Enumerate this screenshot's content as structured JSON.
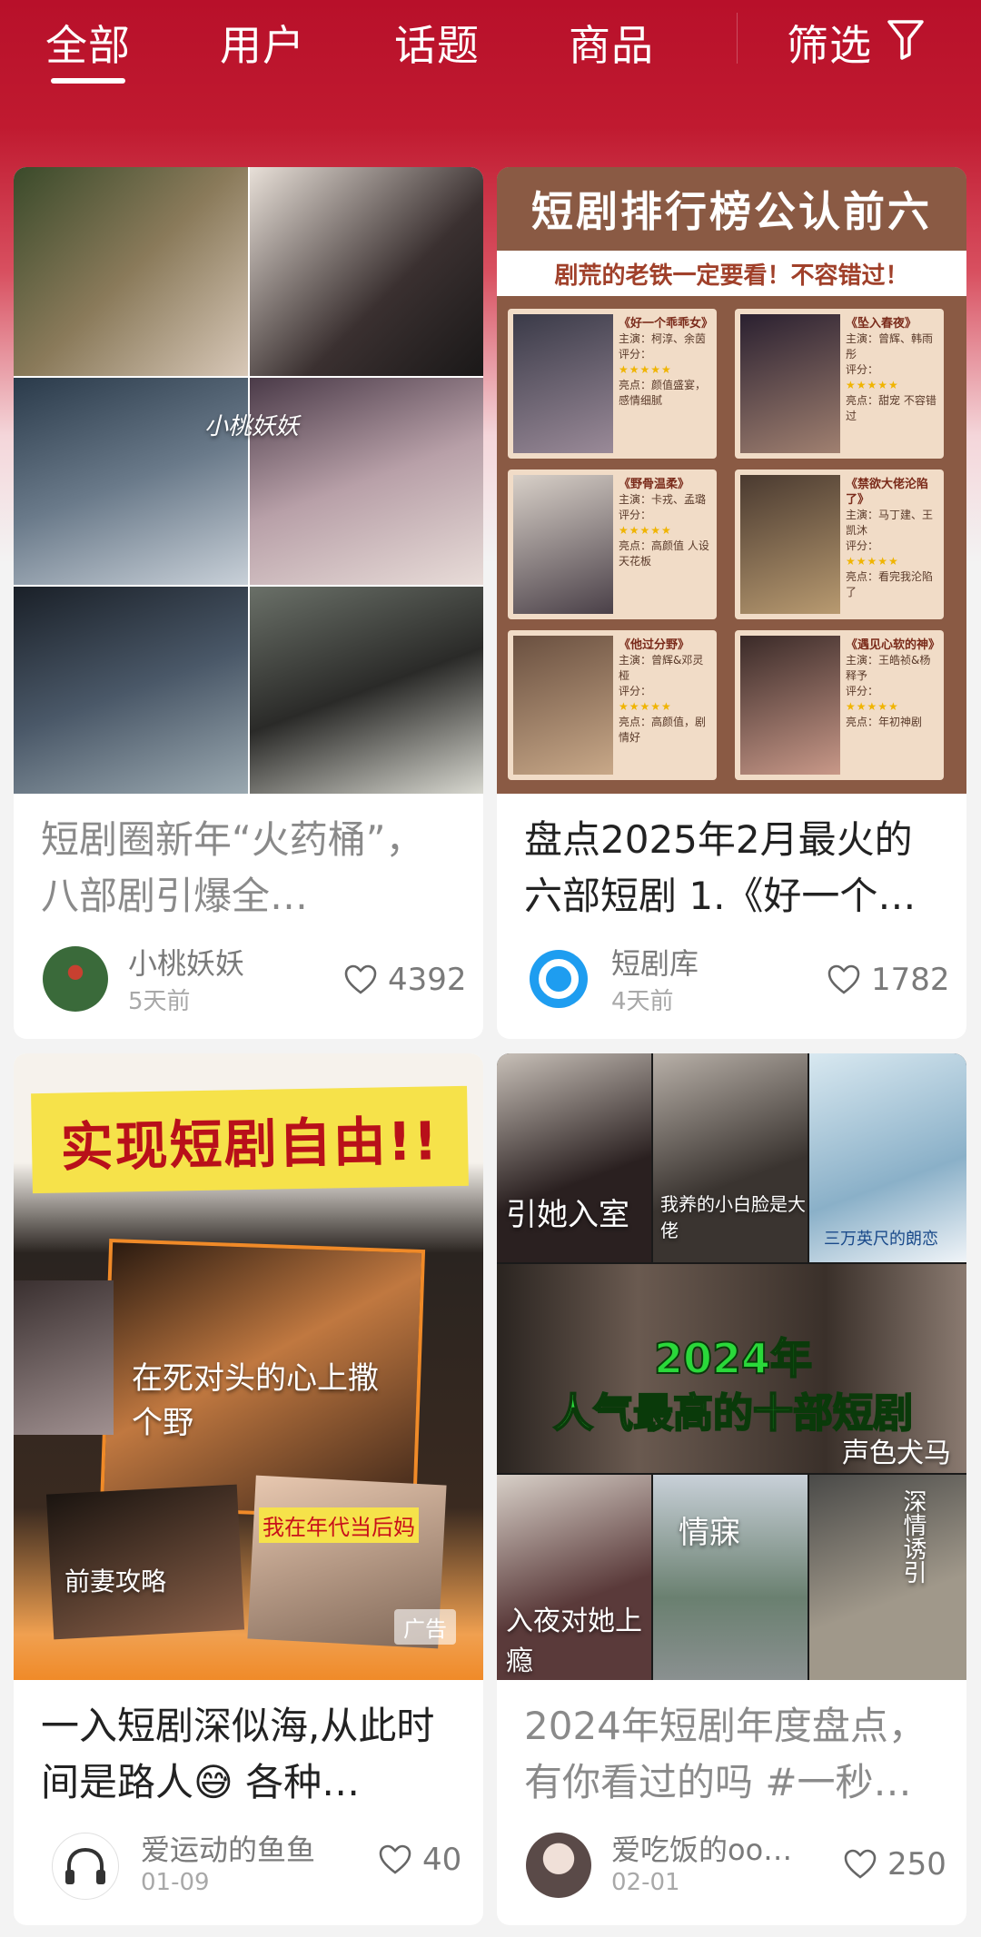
{
  "tabs": [
    {
      "label": "全部",
      "active": true
    },
    {
      "label": "用户",
      "active": false
    },
    {
      "label": "话题",
      "active": false
    },
    {
      "label": "商品",
      "active": false
    }
  ],
  "filter_label": "筛选",
  "cards": [
    {
      "title": "短剧圈新年“火药桶”，八部剧引爆全…",
      "author": "小桃妖妖",
      "time": "5天前",
      "likes": "4392",
      "poster_caption": "小桃妖妖"
    },
    {
      "title": "盘点2025年2月最火的六部短剧 1.《好一个…",
      "author": "短剧库",
      "time": "4天前",
      "likes": "1782",
      "ranking": {
        "banner": "短剧排行榜公认前六",
        "subtitle": "剧荒的老铁一定要看！不容错过！",
        "items": [
          {
            "name": "《好一个乖乖女》",
            "cast": "主演：柯淳、余茵",
            "rating_label": "评分：",
            "highlight": "亮点：颜值盛宴，感情细腻"
          },
          {
            "name": "《坠入春夜》",
            "cast": "主演：曾辉、韩雨彤",
            "rating_label": "评分：",
            "highlight": "亮点：甜宠 不容错过"
          },
          {
            "name": "《野骨温柔》",
            "cast": "主演：卡戎、孟璐",
            "rating_label": "评分：",
            "highlight": "亮点：高颜值 人设天花板"
          },
          {
            "name": "《禁欲大佬沦陷了》",
            "cast": "主演：马丁建、王凯沐",
            "rating_label": "评分：",
            "highlight": "亮点：看完我沦陷了"
          },
          {
            "name": "《他过分野》",
            "cast": "主演：曾辉&邓灵桠",
            "rating_label": "评分：",
            "highlight": "亮点：高颜值，剧情好"
          },
          {
            "name": "《遇见心软的神》",
            "cast": "主演：王皓祯&杨释予",
            "rating_label": "评分：",
            "highlight": "亮点：年初神剧"
          }
        ],
        "stars": "★★★★★"
      }
    },
    {
      "title": "一入短剧深似海,从此时间是路人😅 各种…",
      "author": "爱运动的鱼鱼",
      "time": "01-09",
      "likes": "40",
      "banner": "实现短剧自由!!",
      "ad_label": "广告",
      "posters": [
        "在死对头的心上撒个野",
        "前妻攻略",
        "我在年代当后妈"
      ]
    },
    {
      "title": "2024年短剧年度盘点，有你看过的吗 #一秒…",
      "author": "爱吃饭的oo…",
      "time": "02-01",
      "likes": "250",
      "headline_year": "2024年",
      "headline": "人气最高的十部短剧",
      "posters": [
        "引她入室",
        "我养的小白脸是大佬",
        "三万英尺的朗恋",
        "声色犬马",
        "入夜对她上瘾",
        "情寐",
        "深情诱引"
      ]
    }
  ]
}
